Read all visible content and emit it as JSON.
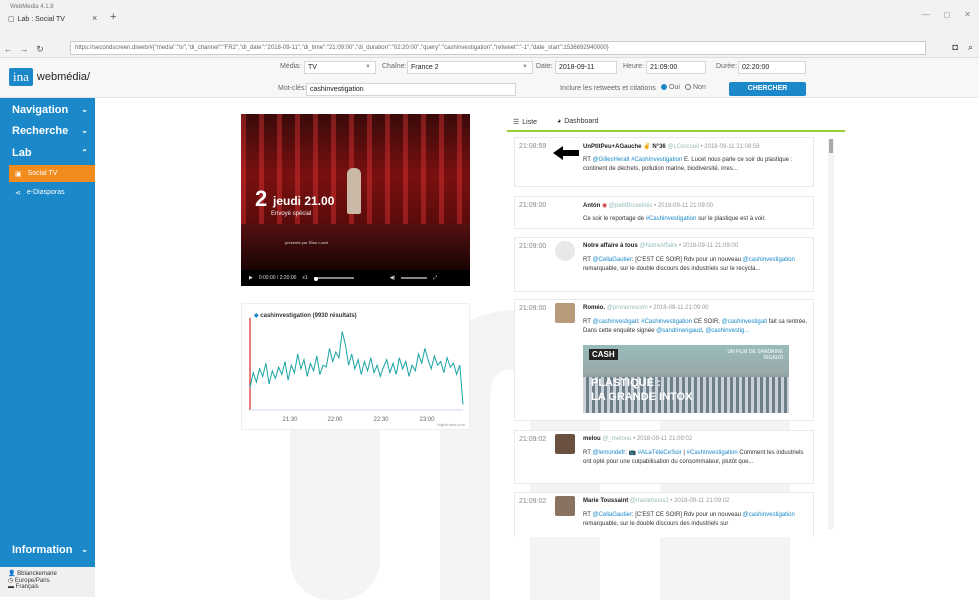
{
  "browser": {
    "app_title": "WebMedia 4.1.8",
    "tab_title": "Lab : Social TV",
    "tab_close": "×",
    "new_tab": "+",
    "url": "https://secondscreen.diweb/#{\"media\":\"tv\",\"di_channel\":\"FR2\",\"di_date\":\"2018-09-11\",\"di_time\":\"21:09:00\",\"di_duration\":\"02:20:00\",\"query\":\"cashinvestigation\",\"retweet\":\"-1\",\"date_start\":1536692940000}"
  },
  "app": {
    "logo_ina": "ina",
    "logo_text": "webmédia/"
  },
  "filters": {
    "media_label": "Média:",
    "media_value": "TV",
    "chaine_label": "Chaîne:",
    "chaine_value": "France 2",
    "date_label": "Date:",
    "date_value": "2018-09-11",
    "heure_label": "Heure:",
    "heure_value": "21:09:00",
    "duree_label": "Durée:",
    "duree_value": "02:20:00",
    "motcles_label": "Mot-clés:",
    "motcles_value": "cashinvestigation",
    "retweets_label": "Inclure les retweets et citations",
    "oui": "Oui",
    "non": "Non",
    "search_label": "CHERCHER"
  },
  "sidebar": {
    "navigation": "Navigation",
    "recherche": "Recherche",
    "lab": "Lab",
    "social_tv": "Social TV",
    "ediasporas": "e-Diasporas",
    "information": "Information",
    "user": "Bblanckemane",
    "timezone": "Europe/Paris",
    "language": "Français"
  },
  "video": {
    "big_number": "2",
    "day_time": "jeudi 21.00",
    "subtitle": "Envoyé spécial",
    "presenter": "présenté par Élise Lucet",
    "time_display": "0:00:00 / 2:20:00",
    "speed": "x1"
  },
  "chart_data": {
    "type": "line",
    "title": "cashinvestigation (9930 résultats)",
    "x_ticks": [
      "21:30",
      "22:00",
      "22:30",
      "23:00"
    ],
    "credit": "Highcharts.com",
    "series": [
      {
        "name": "cashinvestigation (9930 résultats)",
        "values": [
          12,
          20,
          15,
          22,
          18,
          25,
          14,
          21,
          17,
          23,
          19,
          26,
          16,
          24,
          20,
          30,
          22,
          27,
          18,
          25,
          21,
          29,
          19,
          24,
          23,
          33,
          26,
          31,
          28,
          42,
          35,
          24,
          30,
          22,
          27,
          19,
          26,
          21,
          28,
          20,
          24,
          18,
          23,
          27,
          20,
          25,
          19,
          28,
          22,
          26,
          18,
          24,
          21,
          30,
          25,
          33,
          27,
          22,
          29,
          24,
          26,
          20,
          28,
          23,
          25,
          19,
          24,
          3
        ]
      }
    ]
  },
  "feed": {
    "tab_liste": "Liste",
    "tab_dashboard": "Dashboard",
    "posts": [
      {
        "time": "21:08:59",
        "name": "UnPtitPeu+AGauche",
        "num": "N°36",
        "handle": "@LCercouil",
        "date": "• 2018-09-11 21:08:59",
        "text_prefix": "RT ",
        "mention": "@GillesHeralt",
        "hashtag": "#CashInvestigation",
        "text": " E. Lucet nous parle ce soir du plastique : continent de déchets, pollution marine, biodiversité, irres..."
      },
      {
        "time": "21:09:00",
        "name": "Antón",
        "handle": "@petitBruxellois",
        "date": "• 2018-09-11 21:09:00",
        "text": "Ce soir le reportage de ",
        "hashtag": "#Cashinvestigation",
        "text2": " sur le plastique est à voir."
      },
      {
        "time": "21:09:00",
        "name": "Notre affaire à tous",
        "handle": "@NotreAffaire",
        "date": "• 2018-09-11 21:09:00",
        "text_prefix": "RT ",
        "mention": "@CellaGautier",
        "text": ": [C'EST CE SOIR] Rdv pour un nouveau ",
        "hashtag": "@cashinvestigation",
        "text2": " remarquable, sur le double discours des industriels sur le recycla..."
      },
      {
        "time": "21:09:00",
        "name": "Roméo.",
        "handle": "@pronemocom",
        "date": "• 2018-09-11 21:09:00",
        "text_prefix": "RT ",
        "mention": "@cashinvestigati",
        "hashtag": "#Cashinvestigation",
        "text": " CE SOIR, ",
        "mention2": "@cashinvestigati",
        "text2": " fait sa rentrée. Dans cette enquête signée ",
        "mention3": "@sandrinerigaud",
        "mention4": "@cashinvestig...",
        "image_cash": "CASH",
        "image_line1": "PLASTIQUE :",
        "image_line2": "LA GRANDE INTOX",
        "image_credit": "UN FILM DE SANDRINE RIGAUD"
      },
      {
        "time": "21:09:02",
        "name": "melou",
        "handle": "@_melouu",
        "date": "• 2018-09-11 21:09:02",
        "text_prefix": "RT ",
        "mention": "@lemondefr",
        "hashtag": "#ALaTéléCeSoir",
        "text": " | ",
        "hashtag2": "#CashInvestigation",
        "text2": " Comment les industriels ont opté pour une culpabilisation du consommateur, plutôt que..."
      },
      {
        "time": "21:09:02",
        "name": "Marie Toussaint",
        "handle": "@marietouss1",
        "date": "• 2018-09-11 21:09:02",
        "text_prefix": "RT ",
        "mention": "@CellaGautier",
        "text": ": [C'EST CE SOIR] Rdv pour un nouveau ",
        "hashtag": "@cashinvestigation",
        "text2": " remarquable, sur le double discours des industriels sur"
      }
    ]
  }
}
